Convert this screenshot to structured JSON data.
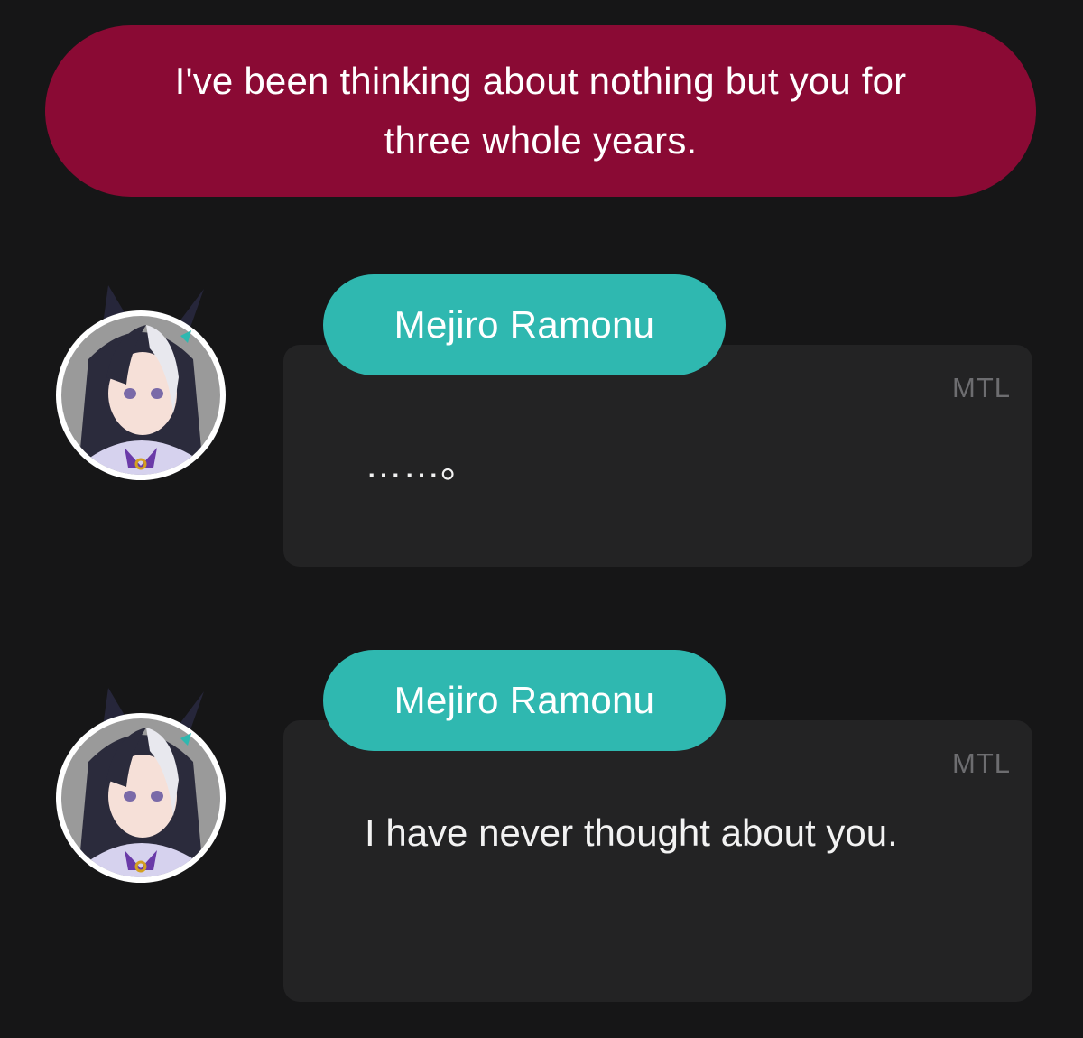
{
  "choice": {
    "text": "I've been thinking about nothing but you for three whole years."
  },
  "messages": [
    {
      "speaker": "Mejiro Ramonu",
      "badge": "MTL",
      "text": "……。"
    },
    {
      "speaker": "Mejiro Ramonu",
      "badge": "MTL",
      "text": "I have never thought about you."
    }
  ],
  "colors": {
    "background": "#161617",
    "choice_bubble": "#8a0a34",
    "name_pill": "#2fb8b0",
    "message_box": "#232324",
    "badge_text": "#6d6d70"
  }
}
